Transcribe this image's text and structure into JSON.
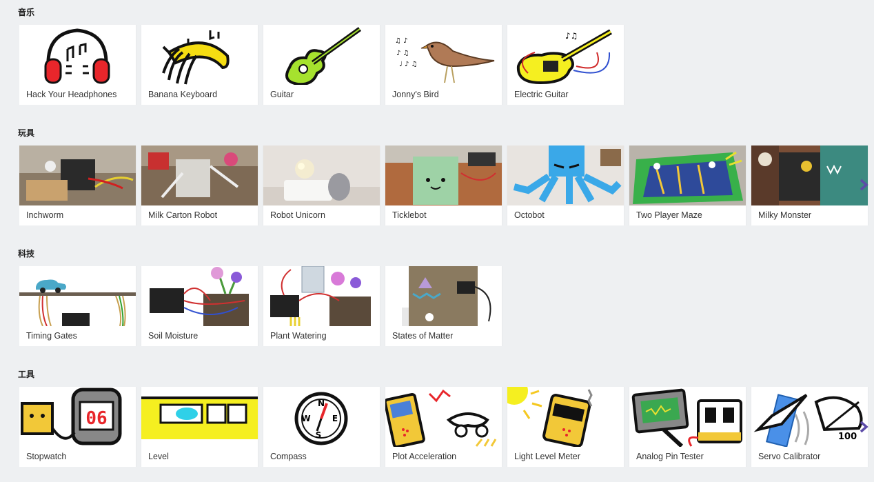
{
  "colors": {
    "background": "#eef0f2",
    "arrow": "#5c4ba8",
    "card": "#ffffff"
  },
  "sections": [
    {
      "title": "音乐",
      "cards": [
        {
          "label": "Hack Your Headphones",
          "icon": "headphones-icon"
        },
        {
          "label": "Banana Keyboard",
          "icon": "banana-icon"
        },
        {
          "label": "Guitar",
          "icon": "guitar-icon"
        },
        {
          "label": "Jonny's Bird",
          "icon": "bird-icon"
        },
        {
          "label": "Electric Guitar",
          "icon": "electric-guitar-icon"
        }
      ]
    },
    {
      "title": "玩具",
      "cards": [
        {
          "label": "Inchworm",
          "icon": "inchworm-photo"
        },
        {
          "label": "Milk Carton Robot",
          "icon": "robot-photo"
        },
        {
          "label": "Robot Unicorn",
          "icon": "unicorn-photo"
        },
        {
          "label": "Ticklebot",
          "icon": "ticklebot-photo"
        },
        {
          "label": "Octobot",
          "icon": "octobot-photo"
        },
        {
          "label": "Two Player Maze",
          "icon": "maze-photo"
        },
        {
          "label": "Milky Monster",
          "icon": "monster-photo"
        }
      ]
    },
    {
      "title": "科技",
      "cards": [
        {
          "label": "Timing Gates",
          "icon": "timing-gates-icon"
        },
        {
          "label": "Soil Moisture",
          "icon": "soil-moisture-icon"
        },
        {
          "label": "Plant Watering",
          "icon": "plant-watering-icon"
        },
        {
          "label": "States of Matter",
          "icon": "states-of-matter-icon"
        }
      ]
    },
    {
      "title": "工具",
      "cards": [
        {
          "label": "Stopwatch",
          "icon": "stopwatch-icon",
          "display": "06"
        },
        {
          "label": "Level",
          "icon": "level-icon"
        },
        {
          "label": "Compass",
          "icon": "compass-icon",
          "letters": [
            "N",
            "E",
            "S",
            "W"
          ]
        },
        {
          "label": "Plot Acceleration",
          "icon": "acceleration-icon"
        },
        {
          "label": "Light Level Meter",
          "icon": "light-meter-icon"
        },
        {
          "label": "Analog Pin Tester",
          "icon": "pin-tester-icon"
        },
        {
          "label": "Servo Calibrator",
          "icon": "servo-icon",
          "text": "100"
        }
      ]
    }
  ]
}
